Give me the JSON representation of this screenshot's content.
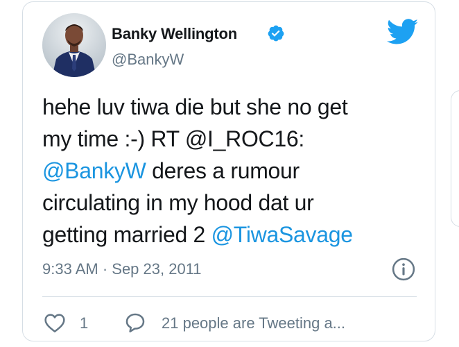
{
  "author": {
    "name": "Banky Wellington",
    "handle": "@BankyW",
    "verified": true
  },
  "icons": {
    "verified": "verified-badge-icon",
    "logo": "twitter-bird-icon",
    "info": "info-icon",
    "like": "heart-icon",
    "reply": "speech-bubble-icon"
  },
  "tweet": {
    "line1": "hehe luv tiwa die but she no get",
    "line2": "my time :-) RT @I_ROC16:",
    "line3_mention": "@BankyW",
    "line3_rest": " deres a rumour",
    "line4": "circulating in my hood dat ur",
    "line5_text": "getting married 2 ",
    "line5_mention": "@TiwaSavage"
  },
  "meta": {
    "timestamp": "9:33 AM · Sep 23, 2011"
  },
  "actions": {
    "like_count": "1",
    "reply_text": "21 people are Tweeting a..."
  },
  "colors": {
    "link": "#1b95e0",
    "text": "#14171a",
    "muted": "#657786",
    "border": "#d6dee5"
  }
}
